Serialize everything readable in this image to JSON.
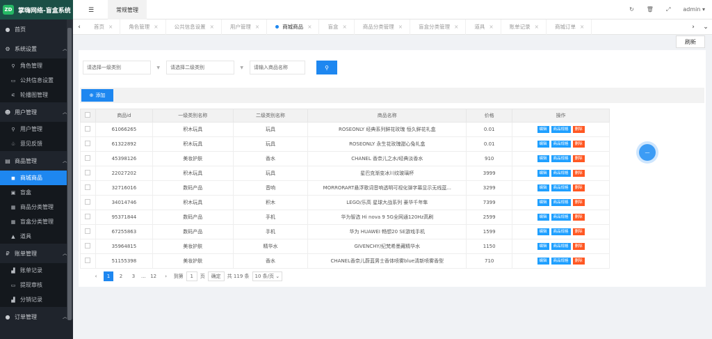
{
  "app": {
    "title": "掌嗨网络-盲盒系统",
    "logo": "ZD"
  },
  "sidebar": {
    "groups": [
      {
        "label": "首页",
        "icon": "dashboard-icon"
      },
      {
        "label": "系统设置",
        "icon": "settings-icon",
        "items": [
          "角色管理",
          "公共信息设置",
          "轮播图管理"
        ]
      },
      {
        "label": "用户管理",
        "icon": "users-icon",
        "items": [
          "用户管理",
          "意见反馈"
        ]
      },
      {
        "label": "商品管理",
        "icon": "shop-icon",
        "items": [
          "商城商品",
          "盲盒",
          "商品分类管理",
          "盲盒分类管理",
          "道具"
        ]
      },
      {
        "label": "账单管理",
        "icon": "bill-icon",
        "items": [
          "账单记录",
          "提现审核",
          "分销记录"
        ]
      },
      {
        "label": "订单管理",
        "icon": "order-icon"
      }
    ]
  },
  "topbar": {
    "tab": "常规管理",
    "user": "admin"
  },
  "tabs": [
    "首页",
    "角色管理",
    "公共信息设置",
    "用户管理",
    "商城商品",
    "盲盒",
    "商品分类管理",
    "盲盒分类管理",
    "道具",
    "账单记录",
    "商城订单"
  ],
  "refresh_label": "刷新",
  "filters": {
    "cat1": "请选择一级类别",
    "cat2": "请选择二级类别",
    "keyword_placeholder": "请输入商品名称"
  },
  "add_label": "添加",
  "table": {
    "headers": [
      "商品id",
      "一级类别名称",
      "二级类别名称",
      "商品名称",
      "价格",
      "操作"
    ],
    "op_labels": [
      "编辑",
      "商品规格",
      "删除"
    ],
    "rows": [
      [
        "61066265",
        "积木玩具",
        "玩具",
        "ROSEONLY 经典系列鲜花玫瑰 恒久鲜花礼盒",
        "0.01"
      ],
      [
        "61322892",
        "积木玩具",
        "玩具",
        "ROSEONLY 永生花玫瑰甜心兔礼盒",
        "0.01"
      ],
      [
        "45398126",
        "美妆护肤",
        "香水",
        "CHANEL 香奈儿之水/经典淡香水",
        "910"
      ],
      [
        "22027202",
        "积木玩具",
        "玩具",
        "星巴克渐变冰川纹玻璃杯",
        "3999"
      ],
      [
        "32716016",
        "数码产品",
        "音响",
        "MORRORART悬浮歌词音响透明可视化弹字幕显示无线蓝...",
        "3299"
      ],
      [
        "34014746",
        "积木玩具",
        "积木",
        "LEGO/乐高 星球大战系列 豪华千年隼",
        "7399"
      ],
      [
        "95371844",
        "数码产品",
        "手机",
        "华为智选 Hi nova 9 5G全网通120Hz高刷",
        "2599"
      ],
      [
        "67255863",
        "数码产品",
        "手机",
        "华为 HUAWEI 畅想20 SE游戏手机",
        "1599"
      ],
      [
        "35964815",
        "美妆护肤",
        "精华水",
        "GIVENCHY/纪梵希墨藏精华水",
        "1150"
      ],
      [
        "51155398",
        "美妆护肤",
        "香水",
        "CHANEL香奈儿蔚蓝男士香体喷雾blue清新喷雾香型",
        "710"
      ]
    ]
  },
  "pager": {
    "pages": [
      "1",
      "2",
      "3",
      "...",
      "12"
    ],
    "goto": "到第",
    "goto_value": "1",
    "page_unit": "页",
    "confirm": "确定",
    "total": "共 119 条",
    "size": "10 条/页"
  },
  "colors": {
    "accent": "#1e87f0",
    "danger": "#ff5722",
    "sidebar": "#1f242c"
  }
}
